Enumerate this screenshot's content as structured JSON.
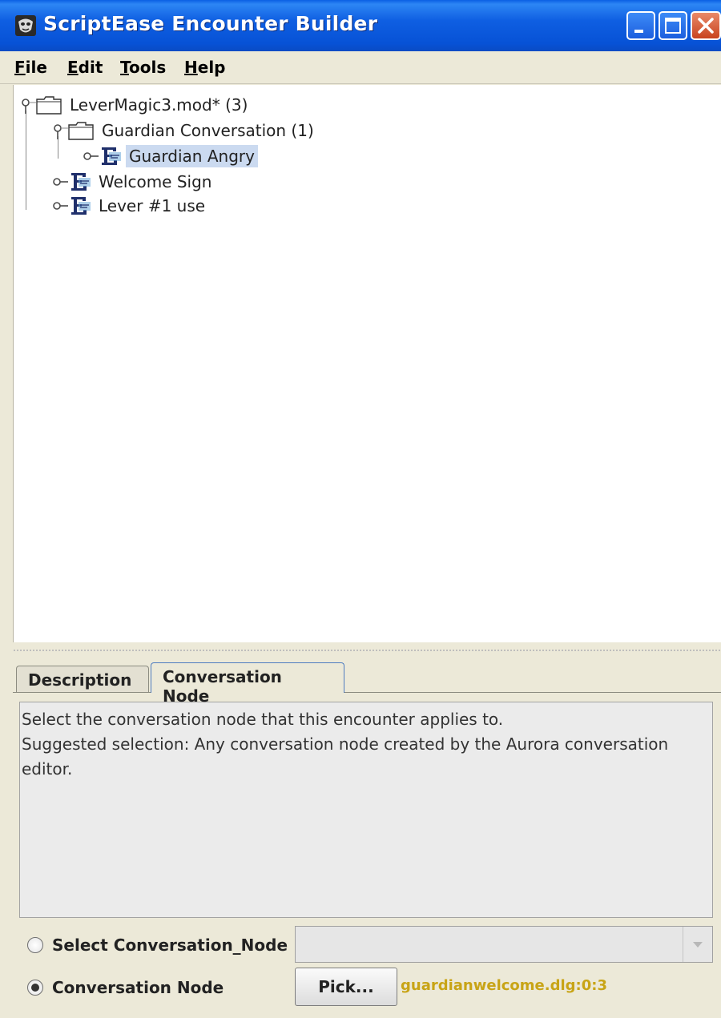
{
  "window": {
    "title": "ScriptEase Encounter Builder",
    "app_icon": "scriptease-mask-icon",
    "controls": [
      "minimize-icon",
      "maximize-icon",
      "close-icon"
    ]
  },
  "menubar": {
    "items": [
      {
        "label_u": "F",
        "label_rest": "ile"
      },
      {
        "label_u": "E",
        "label_rest": "dit"
      },
      {
        "label_u": "T",
        "label_rest": "ools"
      },
      {
        "label_u": "H",
        "label_rest": "elp"
      }
    ]
  },
  "tree": {
    "root": {
      "label": "LeverMagic3.mod* (3)",
      "icon": "folder-icon",
      "expanded": true
    },
    "items": [
      {
        "label": "Guardian Conversation (1)",
        "icon": "folder-icon",
        "expanded": true,
        "level": 1
      },
      {
        "label": "Guardian Angry",
        "icon": "encounter-icon",
        "selected": true,
        "level": 2
      },
      {
        "label": "Welcome Sign",
        "icon": "encounter-icon",
        "level": 1
      },
      {
        "label": "Lever #1 use",
        "icon": "encounter-icon",
        "level": 1
      }
    ]
  },
  "tabs": {
    "items": [
      {
        "label": "Description",
        "active": false
      },
      {
        "label": "Conversation Node",
        "active": true
      }
    ]
  },
  "description": {
    "line1": "Select the conversation node that this encounter applies to.",
    "line2": "Suggested selection: Any conversation node created by the Aurora conversation",
    "line3": "editor."
  },
  "options": {
    "select_label": "Select Conversation_Node",
    "select_checked": false,
    "combo_value": "",
    "node_label": "Conversation Node",
    "node_checked": true,
    "pick_label": "Pick...",
    "node_value": "guardianwelcome.dlg:0:3"
  },
  "colors": {
    "titlebar": "#0752D6",
    "selection": "#cbdaf0",
    "node_value": "#C8A416"
  }
}
